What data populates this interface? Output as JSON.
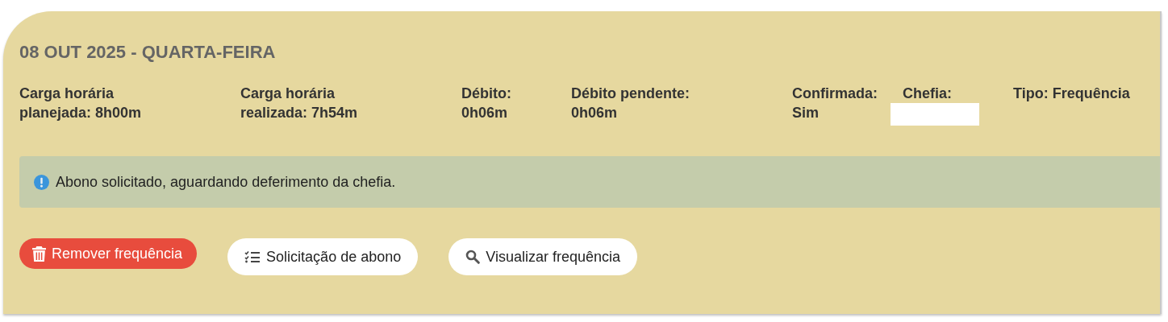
{
  "card": {
    "title": "08 OUT 2025 - QUARTA-FEIRA",
    "fields": [
      {
        "kind": "text",
        "text": "Carga horária planejada: 8h00m"
      },
      {
        "kind": "text",
        "text": "Carga horária realizada: 7h54m"
      },
      {
        "kind": "text",
        "text": "Débito: 0h06m"
      },
      {
        "kind": "text",
        "text": "Débito pendente: 0h06m"
      },
      {
        "kind": "text",
        "text": "Confirmada: Sim"
      },
      {
        "kind": "blank_value",
        "text": "Chefia:"
      },
      {
        "kind": "text",
        "text": "Tipo: Frequência"
      }
    ],
    "alert": {
      "kind": "info",
      "text": "Abono solicitado, aguardando deferimento da chefia."
    },
    "buttons": [
      {
        "kind": "danger",
        "label": "Remover frequência"
      },
      {
        "kind": "default",
        "label": "Solicitação de abono"
      },
      {
        "kind": "default",
        "label": "Visualizar frequência"
      }
    ]
  }
}
